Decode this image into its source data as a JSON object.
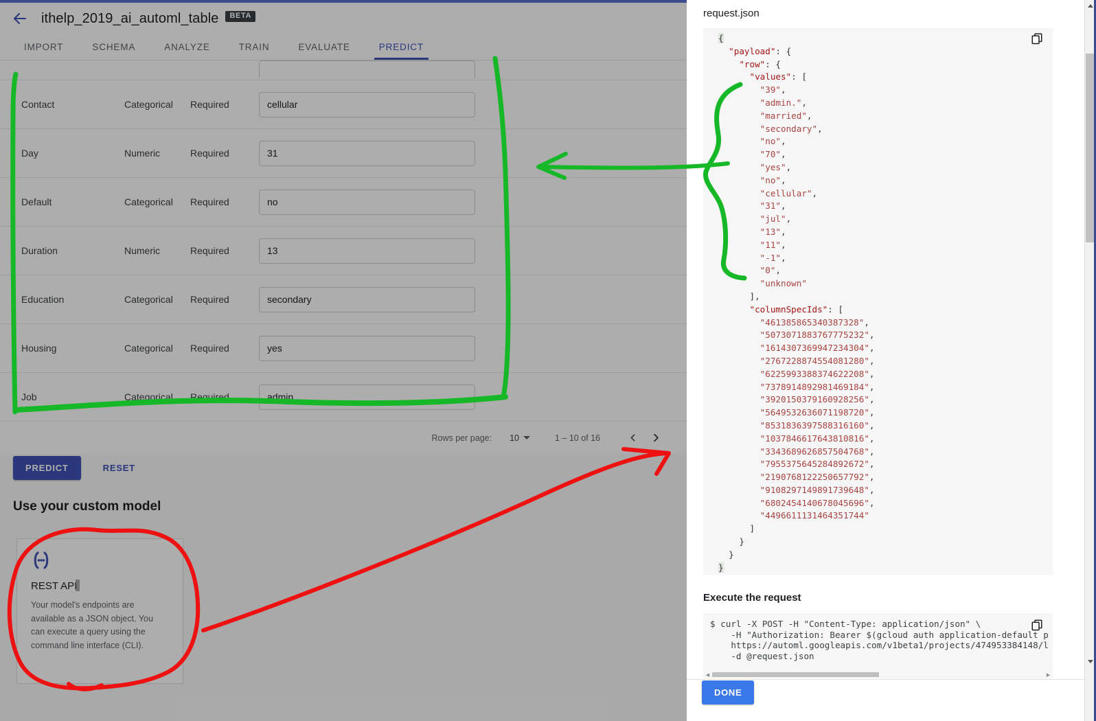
{
  "header": {
    "back_icon": "back-arrow-icon",
    "model_name": "ithelp_2019_ai_automl_table",
    "badge": "BETA"
  },
  "tabs": [
    {
      "label": "IMPORT",
      "active": false
    },
    {
      "label": "SCHEMA",
      "active": false
    },
    {
      "label": "ANALYZE",
      "active": false
    },
    {
      "label": "TRAIN",
      "active": false
    },
    {
      "label": "EVALUATE",
      "active": false
    },
    {
      "label": "PREDICT",
      "active": true
    }
  ],
  "feature_table": {
    "rows": [
      {
        "name": "Contact",
        "type": "Categorical",
        "required": "Required",
        "value": "cellular"
      },
      {
        "name": "Day",
        "type": "Numeric",
        "required": "Required",
        "value": "31"
      },
      {
        "name": "Default",
        "type": "Categorical",
        "required": "Required",
        "value": "no"
      },
      {
        "name": "Duration",
        "type": "Numeric",
        "required": "Required",
        "value": "13"
      },
      {
        "name": "Education",
        "type": "Categorical",
        "required": "Required",
        "value": "secondary"
      },
      {
        "name": "Housing",
        "type": "Categorical",
        "required": "Required",
        "value": "yes"
      },
      {
        "name": "Job",
        "type": "Categorical",
        "required": "Required",
        "value": "admin."
      }
    ],
    "paginator": {
      "rows_per_page_label": "Rows per page:",
      "rows_per_page_value": "10",
      "range_label": "1 – 10 of 16",
      "prev_icon": "chevron-left-icon",
      "next_icon": "chevron-right-icon"
    }
  },
  "actions": {
    "predict_label": "PREDICT",
    "reset_label": "RESET"
  },
  "custom_model": {
    "section_title": "Use your custom model",
    "card": {
      "icon": "code-braces-icon",
      "title": "REST API",
      "description": "Your model's endpoints are available as a JSON object. You can execute a query using the command line interface (CLI)."
    }
  },
  "dialog": {
    "request_title": "request.json",
    "copy_icon": "copy-icon",
    "request_json": {
      "payload_key": "\"payload\"",
      "row_key": "\"row\"",
      "values_key": "\"values\"",
      "values": [
        "\"39\"",
        "\"admin.\"",
        "\"married\"",
        "\"secondary\"",
        "\"no\"",
        "\"70\"",
        "\"yes\"",
        "\"no\"",
        "\"cellular\"",
        "\"31\"",
        "\"jul\"",
        "\"13\"",
        "\"11\"",
        "\"-1\"",
        "\"0\"",
        "\"unknown\""
      ],
      "column_spec_ids_key": "\"columnSpecIds\"",
      "column_spec_ids": [
        "\"461385865340387328\"",
        "\"5073071883767775232\"",
        "\"1614307369947234304\"",
        "\"2767228874554081280\"",
        "\"6225993388374622208\"",
        "\"7378914892981469184\"",
        "\"3920150379160928256\"",
        "\"5649532636071198720\"",
        "\"8531836397588316160\"",
        "\"1037846617643810816\"",
        "\"3343689626857504768\"",
        "\"7955375645284892672\"",
        "\"2190768122250657792\"",
        "\"9108297149891739648\"",
        "\"6802454140678045696\"",
        "\"4496611131464351744\""
      ]
    },
    "execute_title": "Execute the request",
    "curl_lines": [
      "$ curl -X POST -H \"Content-Type: application/json\" \\",
      "    -H \"Authorization: Bearer $(gcloud auth application-default p",
      "    https://automl.googleapis.com/v1beta1/projects/474953384148/l",
      "    -d @request.json"
    ],
    "done_label": "DONE"
  },
  "colors": {
    "primary_indigo": "#3f51b5",
    "done_blue": "#3b78e7",
    "json_string": "#a31515",
    "annotation_green": "#1db954",
    "annotation_red": "#ee1111"
  }
}
